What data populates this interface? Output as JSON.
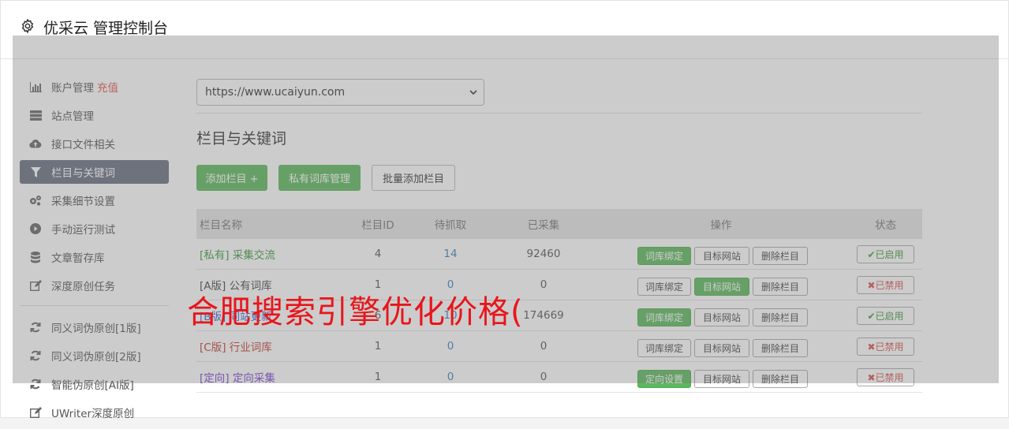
{
  "header": {
    "title": "优采云 管理控制台",
    "icon": "gear-icon"
  },
  "sidebar": {
    "items": [
      {
        "label": "账户管理",
        "extra": "充值",
        "icon": "bar-chart-icon",
        "active": false
      },
      {
        "label": "站点管理",
        "icon": "server-icon",
        "active": false
      },
      {
        "label": "接口文件相关",
        "icon": "cloud-upload-icon",
        "active": false
      },
      {
        "label": "栏目与关键词",
        "icon": "filter-icon",
        "active": true
      },
      {
        "label": "采集细节设置",
        "icon": "gears-icon",
        "active": false
      },
      {
        "label": "手动运行测试",
        "icon": "play-circle-icon",
        "active": false
      },
      {
        "label": "文章暂存库",
        "icon": "database-icon",
        "active": false
      },
      {
        "label": "深度原创任务",
        "icon": "edit-icon",
        "active": false
      }
    ],
    "items2": [
      {
        "label": "同义词伪原创[1版]",
        "icon": "refresh-icon"
      },
      {
        "label": "同义词伪原创[2版]",
        "icon": "refresh-icon"
      },
      {
        "label": "智能伪原创[AI版]",
        "icon": "refresh-icon"
      },
      {
        "label": "UWriter深度原创",
        "icon": "edit-icon"
      }
    ]
  },
  "main": {
    "site_select": "https://www.ucaiyun.com",
    "section_title": "栏目与关键词",
    "buttons": {
      "add": "添加栏目 +",
      "private_lib": "私有词库管理",
      "batch_add": "批量添加栏目"
    },
    "table": {
      "headers": {
        "name": "栏目名称",
        "id": "栏目ID",
        "pending": "待抓取",
        "collected": "已采集",
        "ops": "操作",
        "status": "状态"
      },
      "rows": [
        {
          "tag": "[私有]",
          "name": "采集交流",
          "id": "4",
          "pending": "14",
          "collected": "92460",
          "op1": "词库绑定",
          "op1_green": true,
          "op2": "目标网站",
          "op2_green": false,
          "op3": "删除栏目",
          "status": "✔已启用",
          "status_on": true
        },
        {
          "tag": "[A版]",
          "name": "公有词库",
          "id": "1",
          "pending": "0",
          "collected": "0",
          "op1": "词库绑定",
          "op1_green": false,
          "op2": "目标网站",
          "op2_green": true,
          "op3": "删除栏目",
          "status": "✖已禁用",
          "status_on": false
        },
        {
          "tag": "[B版]",
          "name": "同站更新",
          "id": "6",
          "pending": "10",
          "collected": "174669",
          "op1": "词库绑定",
          "op1_green": true,
          "op2": "目标网站",
          "op2_green": false,
          "op3": "删除栏目",
          "status": "✔已启用",
          "status_on": true
        },
        {
          "tag": "[C版]",
          "name": "行业词库",
          "id": "1",
          "pending": "0",
          "collected": "0",
          "op1": "词库绑定",
          "op1_green": false,
          "op2": "目标网站",
          "op2_green": false,
          "op3": "删除栏目",
          "status": "✖已禁用",
          "status_on": false
        },
        {
          "tag": "[定向]",
          "name": "定向采集",
          "id": "1",
          "pending": "0",
          "collected": "0",
          "op1": "定向设置",
          "op1_green": true,
          "op2": "目标网站",
          "op2_green": false,
          "op3": "删除栏目",
          "status": "✖已禁用",
          "status_on": false
        }
      ]
    }
  },
  "watermark": "合肥搜索引擎优化价格("
}
